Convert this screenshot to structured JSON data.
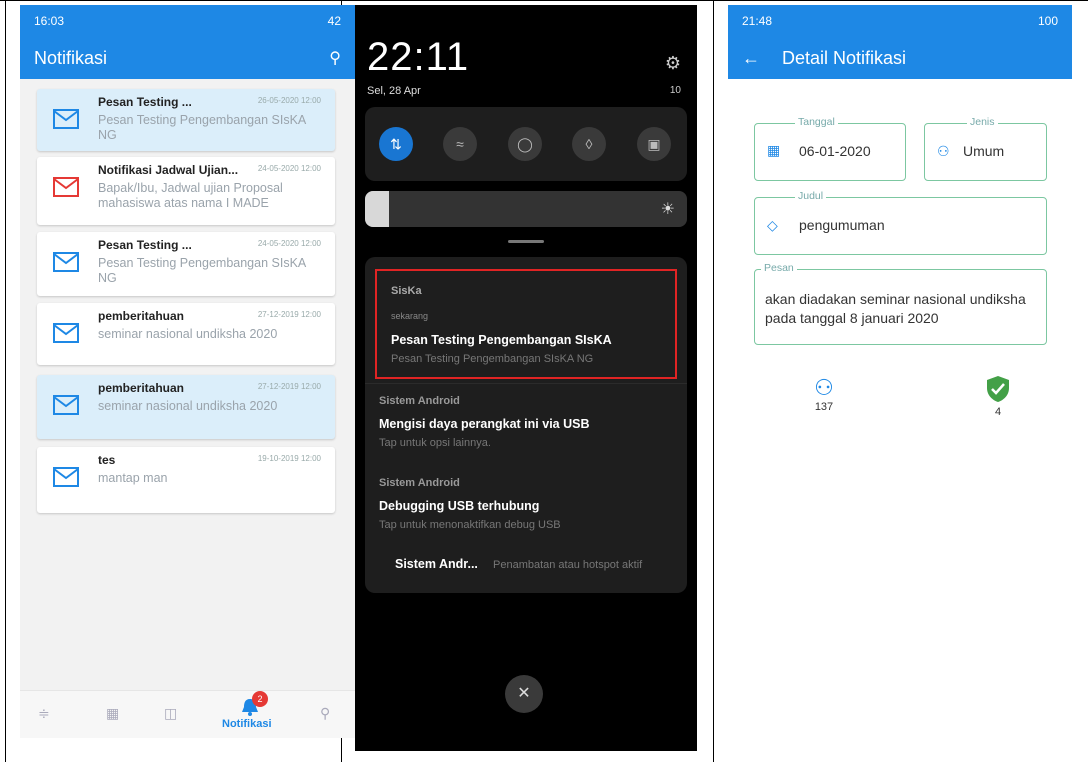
{
  "panel1": {
    "status_time": "16:03",
    "status_right": "42",
    "title": "Notifikasi",
    "cards": [
      {
        "title": "Pesan Testing ...",
        "date": "26-05-2020 12:00",
        "body": "Pesan Testing Pengembangan SIsKA NG",
        "icon_color": "#1e88e5",
        "highlight": true
      },
      {
        "title": "Notifikasi Jadwal Ujian...",
        "date": "24-05-2020 12:00",
        "body": "Bapak/Ibu, Jadwal ujian Proposal mahasiswa atas nama I MADE",
        "icon_color": "#e53935",
        "highlight": false
      },
      {
        "title": "Pesan Testing ...",
        "date": "24-05-2020 12:00",
        "body": "Pesan Testing Pengembangan SIsKA NG",
        "icon_color": "#1e88e5",
        "highlight": false
      },
      {
        "title": "pemberitahuan",
        "date": "27-12-2019 12:00",
        "body": "seminar nasional undiksha 2020",
        "icon_color": "#1e88e5",
        "highlight": false
      },
      {
        "title": "pemberitahuan",
        "date": "27-12-2019 12:00",
        "body": "seminar nasional undiksha 2020",
        "icon_color": "#1e88e5",
        "highlight": true
      },
      {
        "title": "tes",
        "date": "19-10-2019 12:00",
        "body": "mantap man",
        "icon_color": "#1e88e5",
        "highlight": false
      }
    ],
    "nav": {
      "active_label": "Notifikasi",
      "badge": "2"
    }
  },
  "panel2": {
    "time": "22:11",
    "date": "Sel, 28 Apr",
    "battery": "10",
    "notifications": {
      "app1": "SisKa",
      "when1": "sekarang",
      "title1": "Pesan Testing Pengembangan SIsKA",
      "body1": "Pesan Testing Pengembangan SIsKA NG",
      "app2": "Sistem Android",
      "title2": "Mengisi daya perangkat ini via USB",
      "body2": "Tap untuk opsi lainnya.",
      "app3": "Sistem Android",
      "title3": "Debugging USB terhubung",
      "body3": "Tap untuk menonaktifkan debug USB",
      "app4": "Sistem Andr...",
      "body4": "Penambatan atau hotspot aktif"
    },
    "close_glyph": "✕"
  },
  "panel3": {
    "status_time": "21:48",
    "status_right": "100",
    "title": "Detail Notifikasi",
    "tanggal_label": "Tanggal",
    "tanggal_value": "06-01-2020",
    "jenis_label": "Jenis",
    "jenis_value": "Umum",
    "judul_label": "Judul",
    "judul_value": "pengumuman",
    "pesan_label": "Pesan",
    "pesan_value": "akan diadakan seminar nasional undiksha pada tanggal 8 januari 2020",
    "readers_count": "137",
    "confirmed_count": "4"
  }
}
